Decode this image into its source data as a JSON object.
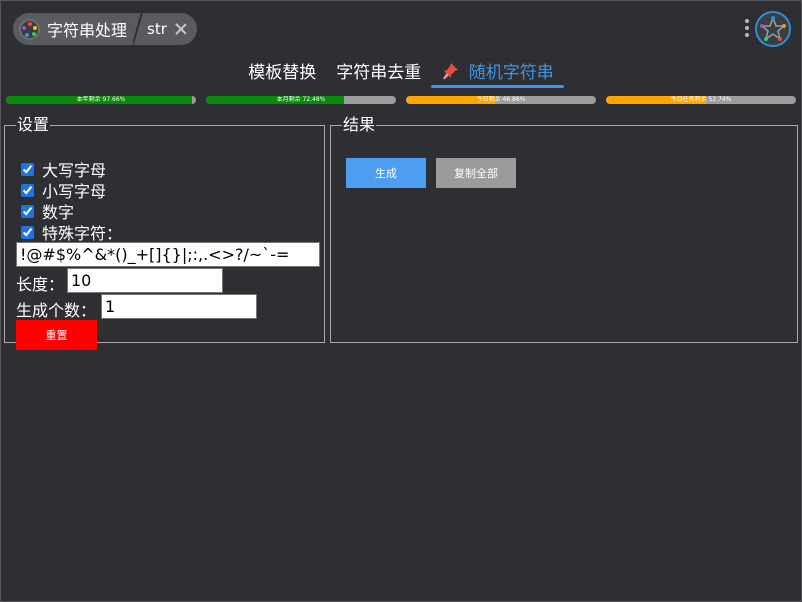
{
  "header": {
    "app_title": "字符串处理",
    "tab_label": "str",
    "logo_icon": "app-logo-icon",
    "close_icon": "close-icon",
    "menu_icon": "kebab-menu-icon",
    "avatar_icon": "avatar-icon"
  },
  "tabs": [
    {
      "label": "模板替换",
      "active": false
    },
    {
      "label": "字符串去重",
      "active": false
    },
    {
      "label": "随机字符串",
      "active": true,
      "icon": "pin-icon"
    }
  ],
  "quota_bars": [
    {
      "label": "本年剩余 97.66%",
      "fill": 0.9766,
      "color": "#0a8a0a"
    },
    {
      "label": "本月剩余 72.48%",
      "fill": 0.7248,
      "color": "#0a8a0a"
    },
    {
      "label": "今日剩余 46.86%",
      "fill": 0.4686,
      "color": "#ffa500"
    },
    {
      "label": "今日任务剩余 52.74%",
      "fill": 0.5274,
      "color": "#ffa500"
    }
  ],
  "settings": {
    "legend": "设置",
    "options": [
      {
        "label": "大写字母",
        "checked": true
      },
      {
        "label": "小写字母",
        "checked": true
      },
      {
        "label": "数字",
        "checked": true
      },
      {
        "label": "特殊字符：",
        "checked": true
      }
    ],
    "special_chars_value": "!@#$%^&*()_+[]{}|;:,.<>?/~`-=",
    "length_label": "长度：",
    "length_value": "10",
    "count_label": "生成个数：",
    "count_value": "1",
    "reset_label": "重置"
  },
  "results": {
    "legend": "结果",
    "generate_label": "生成",
    "copy_all_label": "复制全部"
  },
  "colors": {
    "background": "#2e2f33",
    "accent": "#3d95e6",
    "reset": "#ff0000",
    "generate": "#4d9ef0",
    "copy": "#9b9b9b"
  }
}
